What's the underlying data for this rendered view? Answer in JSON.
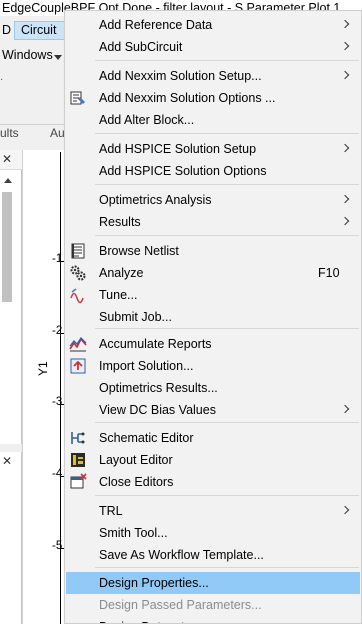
{
  "window": {
    "title": "EdgeCoupleBPF Opt Done - filter layout - S Parameter Plot 1"
  },
  "menubar": {
    "left_fragment": "D",
    "circuit": "Circuit"
  },
  "toolbar": {
    "windows_label": "Windows",
    "mark": "·"
  },
  "tabs": {
    "results_fragment": "ults",
    "au_fragment": "Au"
  },
  "plot": {
    "ylabel": "Y1",
    "yticks": [
      "-1",
      "-2",
      "-3",
      "-4",
      "-5"
    ]
  },
  "context_menu": {
    "items": [
      {
        "label": "Add Reference Data",
        "submenu": true
      },
      {
        "label": "Add SubCircuit",
        "submenu": true
      },
      {
        "label": "Add Nexxim Solution Setup...",
        "submenu": true
      },
      {
        "label": "Add Nexxim Solution Options ...",
        "icon": "nexxim-options-icon"
      },
      {
        "label": "Add Alter Block..."
      },
      {
        "label": "Add HSPICE Solution Setup",
        "submenu": true
      },
      {
        "label": "Add HSPICE Solution Options"
      },
      {
        "label": "Optimetrics Analysis",
        "submenu": true
      },
      {
        "label": "Results",
        "submenu": true
      },
      {
        "label": "Browse Netlist",
        "icon": "browse-netlist-icon"
      },
      {
        "label": "Analyze",
        "shortcut": "F10",
        "icon": "analyze-icon"
      },
      {
        "label": "Tune...",
        "icon": "tune-icon"
      },
      {
        "label": "Submit Job..."
      },
      {
        "label": "Accumulate Reports",
        "icon": "accumulate-reports-icon"
      },
      {
        "label": "Import Solution...",
        "icon": "import-solution-icon"
      },
      {
        "label": "Optimetrics Results..."
      },
      {
        "label": "View DC Bias Values",
        "submenu": true
      },
      {
        "label": "Schematic Editor",
        "icon": "schematic-editor-icon"
      },
      {
        "label": "Layout Editor",
        "icon": "layout-editor-icon"
      },
      {
        "label": "Close Editors",
        "icon": "close-editors-icon"
      },
      {
        "label": "TRL",
        "submenu": true
      },
      {
        "label": "Smith Tool..."
      },
      {
        "label": "Save As Workflow Template..."
      },
      {
        "label": "Design Properties...",
        "highlighted": true
      },
      {
        "label": "Design Passed Parameters...",
        "disabled": true
      },
      {
        "label": "Design Datasets..."
      }
    ]
  },
  "colors": {
    "highlight": "#91c9f7",
    "menu_bg": "#f2f2f2",
    "disabled_text": "#8c8c8c"
  }
}
